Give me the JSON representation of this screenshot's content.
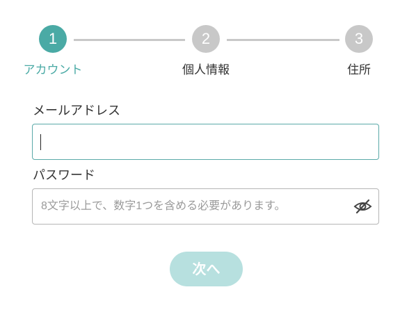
{
  "colors": {
    "accent": "#4aaaa5",
    "inactive": "#c8c8c8",
    "button_disabled": "#b7e0df"
  },
  "stepper": {
    "current_step": 1,
    "steps": [
      {
        "number": "1",
        "label": "アカウント",
        "state": "active"
      },
      {
        "number": "2",
        "label": "個人情報",
        "state": "inactive"
      },
      {
        "number": "3",
        "label": "住所",
        "state": "inactive"
      }
    ]
  },
  "form": {
    "email": {
      "label": "メールアドレス",
      "value": "",
      "placeholder": ""
    },
    "password": {
      "label": "パスワード",
      "value": "",
      "placeholder": "8文字以上で、数字1つを含める必要があります。",
      "toggle_icon": "eye-off-icon"
    }
  },
  "next_button": {
    "label": "次へ",
    "state": "disabled"
  }
}
